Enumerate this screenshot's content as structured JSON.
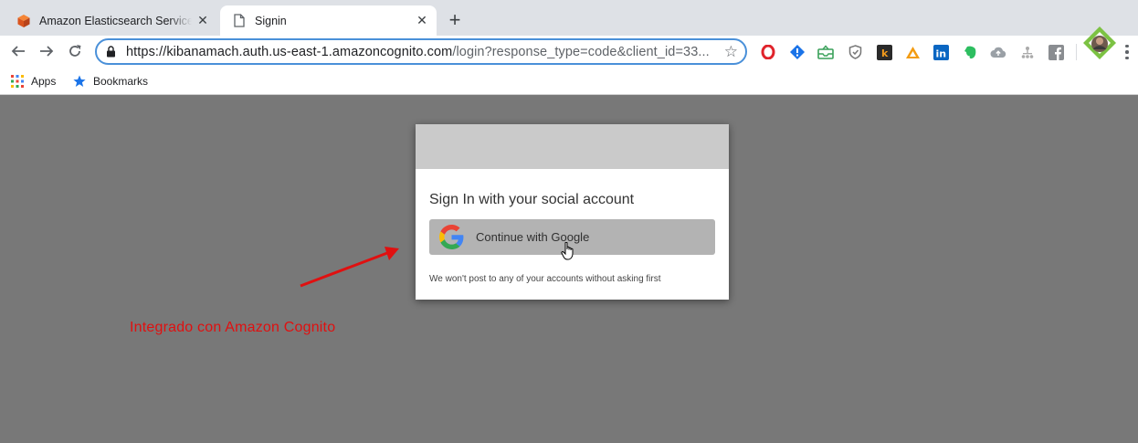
{
  "tabs": [
    {
      "title": "Amazon Elasticsearch Service (",
      "favicon": "aws-cube-icon"
    },
    {
      "title": "Signin",
      "favicon": "document-icon"
    }
  ],
  "address_bar": {
    "url_host": "https://kibanamach.auth.us-east-1.amazoncognito.com",
    "url_rest": "/login?response_type=code&client_id=33..."
  },
  "bookmarks": [
    {
      "label": "Apps",
      "icon": "apps-grid-icon"
    },
    {
      "label": "Bookmarks",
      "icon": "star-icon"
    }
  ],
  "dialog": {
    "heading": "Sign In with your social account",
    "google_button": "Continue with Google",
    "footnote": "We won't post to any of your accounts without asking first"
  },
  "annotation": {
    "caption": "Integrado con Amazon Cognito",
    "color": "#e01010"
  },
  "colors": {
    "omnibox_focus": "#4a90d9",
    "page_background": "#787878",
    "dialog_header": "#cacaca",
    "google_button": "#b3b3b3"
  }
}
